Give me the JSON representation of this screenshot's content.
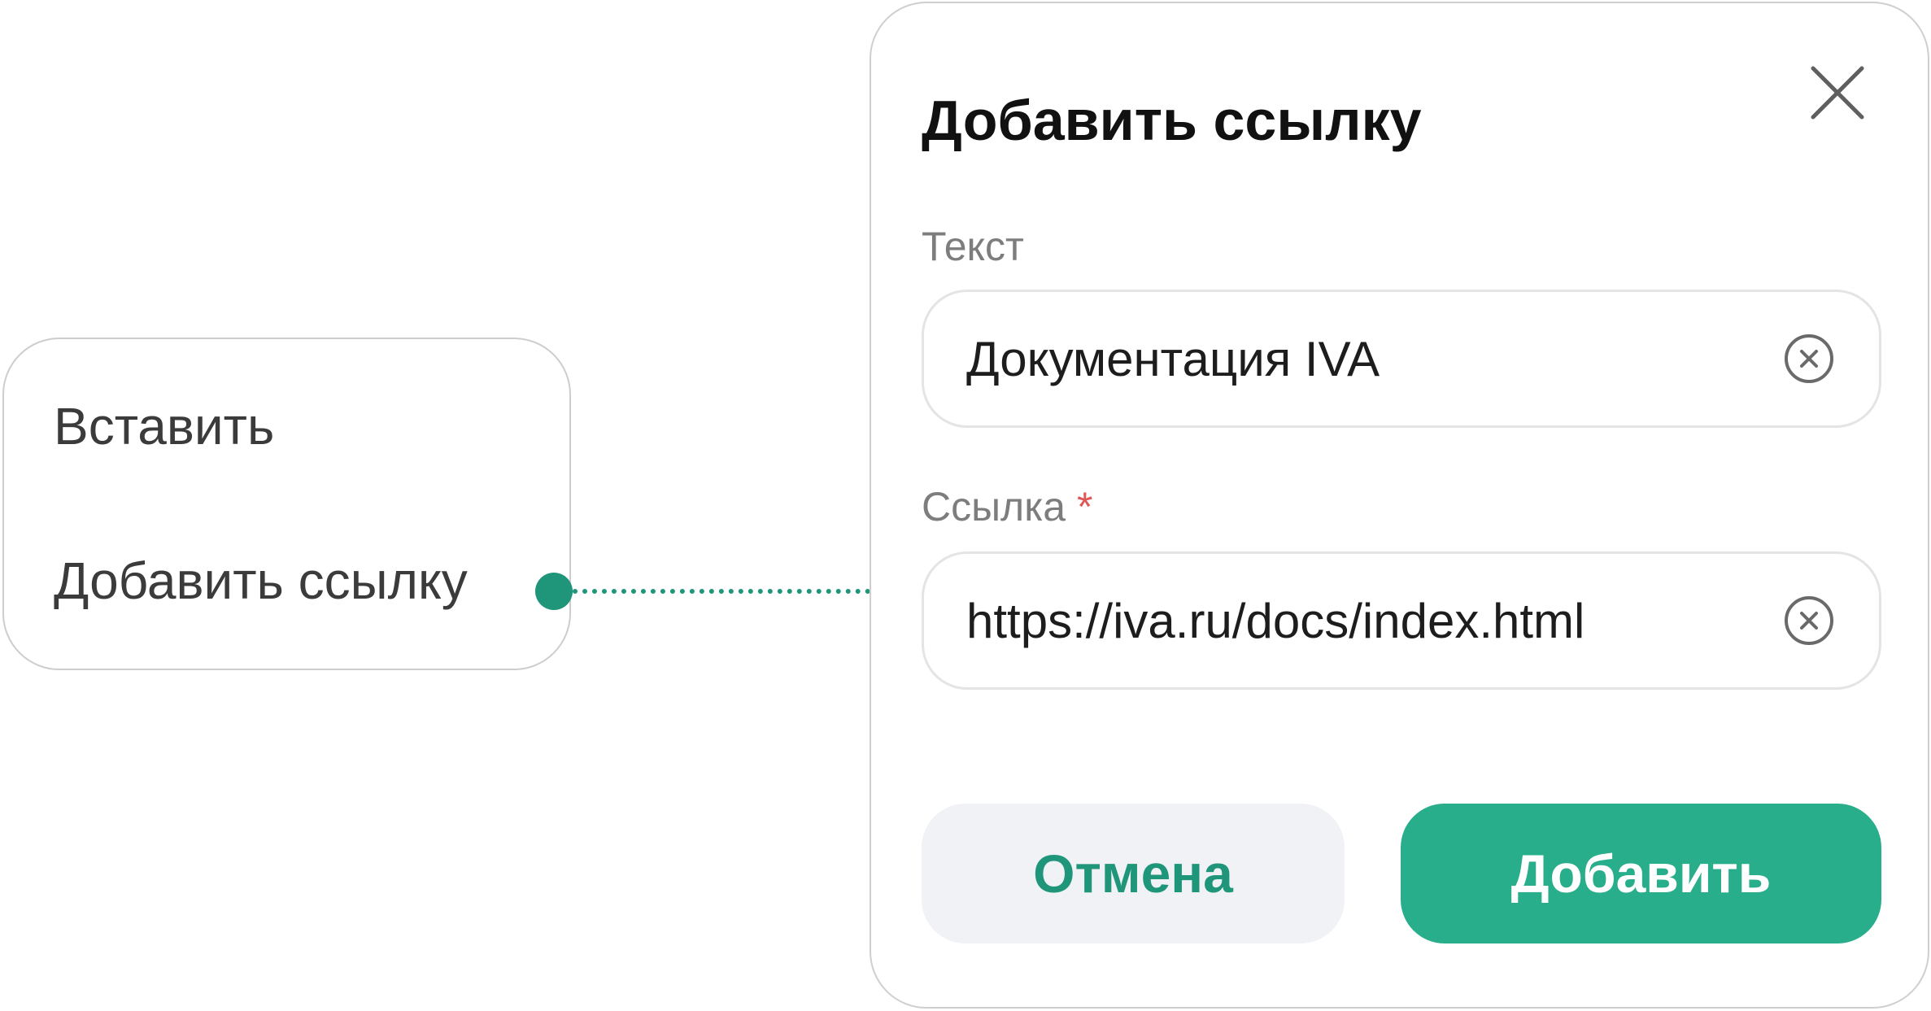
{
  "context_menu": {
    "items": [
      {
        "label": "Вставить"
      },
      {
        "label": "Добавить ссылку"
      }
    ]
  },
  "dialog": {
    "title": "Добавить ссылку",
    "close_icon": "close-icon",
    "fields": {
      "text": {
        "label": "Текст",
        "value": "Документация IVA",
        "required": false,
        "clear_icon": "clear-circle-icon"
      },
      "link": {
        "label": "Ссылка",
        "required_mark": "*",
        "value": "https://iva.ru/docs/index.html",
        "required": true,
        "clear_icon": "clear-circle-icon"
      }
    },
    "buttons": {
      "cancel_label": "Отмена",
      "add_label": "Добавить"
    }
  },
  "colors": {
    "accent": "#29ae8c",
    "accent_dark": "#1f957a",
    "required": "#e05656",
    "cancel_bg": "#f0f2f5"
  }
}
